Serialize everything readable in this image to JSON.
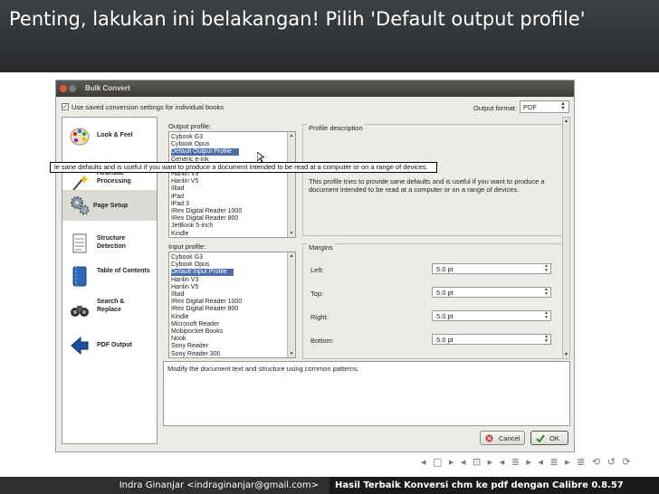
{
  "slide": {
    "title": "Penting, lakukan ini belakangan! Pilih 'Default output profile'",
    "footer_left": "Indra Ginanjar <indraginanjar@gmail.com>",
    "footer_right": "Hasil Terbaik Konversi chm ke pdf dengan Calibre 0.8.57",
    "nav_symbols": "◂ □ ▸ ◂ ⊡ ▸ ◂ ≣ ▸ ◂ ≣ ▸ ≣ ⟲ ↺ ⟳"
  },
  "dialog": {
    "title": "Bulk Convert",
    "use_saved_label": "Use saved conversion settings for individual books",
    "output_format_label": "Output format:",
    "output_format_value": "PDF",
    "sidebar": [
      {
        "label": "Look & Feel",
        "icon": "palette-icon"
      },
      {
        "label": "Heuristic Processing",
        "icon": "wizard-icon"
      },
      {
        "label": "Page Setup",
        "icon": "gears-icon"
      },
      {
        "label": "Structure Detection",
        "icon": "document-icon"
      },
      {
        "label": "Table of Contents",
        "icon": "book-icon"
      },
      {
        "label": "Search & Replace",
        "icon": "binoculars-icon"
      },
      {
        "label": "PDF Output",
        "icon": "arrow-left-icon"
      }
    ],
    "output_profile_label": "Output profile:",
    "output_profiles": [
      "Cybook G3",
      "Cybook Opus",
      "Default Output Profile",
      "Generic e-ink",
      "Generic e-ink large",
      "Hanlin V3",
      "Hanlin V5",
      "Illiad",
      "iPad",
      "iPad 3",
      "IRex Digital Reader 1000",
      "IRex Digital Reader 800",
      "JetBook 5-inch",
      "Kindle"
    ],
    "output_selected_index": 2,
    "input_profile_label": "Input profile:",
    "input_profiles": [
      "Cybook G3",
      "Cybook Opus",
      "Default Input Profile",
      "Hanlin V3",
      "Hanlin V5",
      "Illiad",
      "IRex Digital Reader 1000",
      "IRex Digital Reader 800",
      "Kindle",
      "Microsoft Reader",
      "Mobipocket Books",
      "Nook",
      "Sony Reader",
      "Sony Reader 300"
    ],
    "input_selected_index": 2,
    "profile_description_label": "Profile description",
    "profile_description_text": "This profile tries to provide sane defaults and is useful if you want to produce a document intended to be read at a computer or on a range of devices.",
    "margins_label": "Margins",
    "margins": [
      {
        "label": "Left:",
        "value": "5.0 pt"
      },
      {
        "label": "Top:",
        "value": "5.0 pt"
      },
      {
        "label": "Right:",
        "value": "5.0 pt"
      },
      {
        "label": "Bottom:",
        "value": "5.0 pt"
      }
    ],
    "help_text": "Modify the document text and structure using common patterns.",
    "cancel_label": "Cancel",
    "ok_label": "OK",
    "tooltip_text": "le sane defaults and is useful if you want to produce a document intended to be read at a computer or on a range of devices."
  }
}
